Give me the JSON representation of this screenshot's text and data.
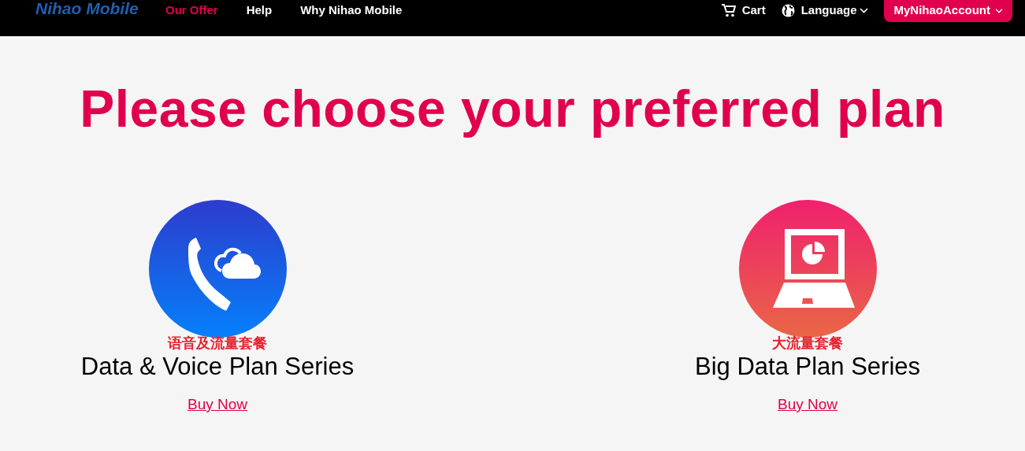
{
  "header": {
    "logo": "Nihao Mobile",
    "nav": [
      {
        "label": "Our Offer",
        "selected": true
      },
      {
        "label": "Help",
        "selected": false
      },
      {
        "label": "Why Nihao Mobile",
        "selected": false
      }
    ],
    "cart": "Cart",
    "language": "Language",
    "account": "MyNihaoAccount"
  },
  "title": "Please choose your preferred plan",
  "plans": [
    {
      "kind": "voice",
      "caption": "语音及流量套餐",
      "name": "Data & Voice Plan Series",
      "link": "Buy Now"
    },
    {
      "kind": "data",
      "caption": "大流量套餐",
      "name": "Big Data Plan Series",
      "link": "Buy Now"
    }
  ]
}
